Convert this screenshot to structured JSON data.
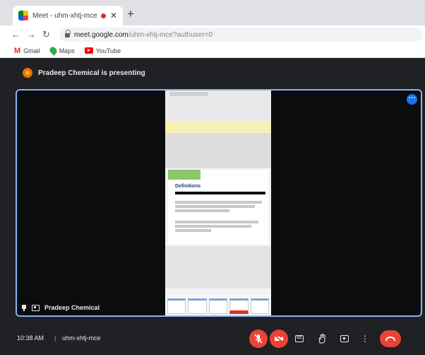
{
  "browser": {
    "tab": {
      "title": "Meet - uhm-xhtj-mce",
      "recording": true
    },
    "address": {
      "url_main": "meet.google.com",
      "url_rest": "/uhm-xhtj-mce?authuser=0"
    },
    "bookmarks": [
      {
        "label": "Gmail",
        "icon": "gmail-icon"
      },
      {
        "label": "Maps",
        "icon": "maps-icon"
      },
      {
        "label": "YouTube",
        "icon": "youtube-icon"
      }
    ]
  },
  "meet": {
    "presenter_banner": "Pradeep Chemical is presenting",
    "tile_name": "Pradeep Chemical",
    "time": "10:38 AM",
    "separator": "|",
    "meeting_code": "uhm-xhtj-mce",
    "colors": {
      "accent": "#8ab4f8",
      "danger": "#ea4335",
      "background": "#202124"
    }
  },
  "shared_screen": {
    "slide_title": "Definitions",
    "icons": [
      "phone-screen-icon"
    ]
  }
}
